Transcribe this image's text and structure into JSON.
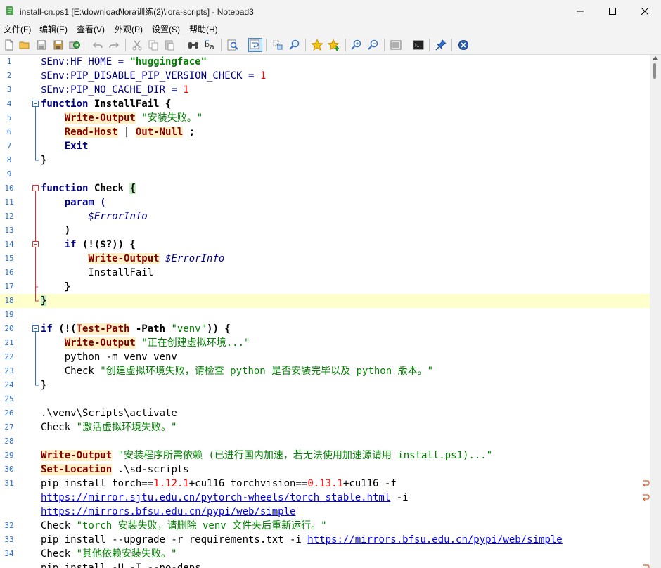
{
  "window": {
    "title": "install-cn.ps1 [E:\\download\\lora训练(2)\\lora-scripts] - Notepad3",
    "app_icon": "notepad3-icon"
  },
  "menu": [
    "文件(F)",
    "编辑(E)",
    "查看(V)",
    "外观(P)",
    "设置(S)",
    "帮助(H)"
  ],
  "toolbar_icons": [
    "new-file-icon",
    "open-folder-icon",
    "save-icon",
    "save-as-icon",
    "browse-icon",
    "undo-icon",
    "redo-icon",
    "cut-icon",
    "copy-icon",
    "paste-icon",
    "find-icon",
    "replace-icon",
    "find-in-files-icon",
    "word-wrap-icon",
    "select-block-icon",
    "zoom-find-icon",
    "add-favorite-icon",
    "favorites-icon",
    "zoom-in-icon",
    "zoom-out-icon",
    "document-view-icon",
    "command-prompt-icon",
    "pin-icon",
    "close-file-icon"
  ],
  "line_numbers": [
    "1",
    "2",
    "3",
    "4",
    "5",
    "6",
    "7",
    "8",
    "",
    "10",
    "11",
    "12",
    "13",
    "14",
    "15",
    "16",
    "17",
    "18",
    "",
    "20",
    "21",
    "22",
    "23",
    "24",
    "",
    "26",
    "27",
    "28",
    "29",
    "30",
    "31",
    "",
    "",
    "32",
    "33",
    "34"
  ],
  "code": {
    "l1": [
      "$Env:HF_HOME = ",
      "\"huggingface\""
    ],
    "l2": [
      "$Env:PIP_DISABLE_PIP_VERSION_CHECK = ",
      "1"
    ],
    "l3": [
      "$Env:PIP_NO_CACHE_DIR = ",
      "1"
    ],
    "l4": [
      "function",
      " InstallFail {"
    ],
    "l5": [
      "    ",
      "Write-Output",
      " ",
      "\"安装失败。\""
    ],
    "l6": [
      "    ",
      "Read-Host",
      " | ",
      "Out-Null",
      " ;"
    ],
    "l7": [
      "    Exit"
    ],
    "l8": [
      "}"
    ],
    "l10": [
      "function",
      " Check ",
      "{"
    ],
    "l11": [
      "    param ("
    ],
    "l12": [
      "        ",
      "$ErrorInfo"
    ],
    "l13": [
      "    )"
    ],
    "l14": [
      "    if",
      " (!($?)) {"
    ],
    "l15": [
      "        ",
      "Write-Output",
      " ",
      "$ErrorInfo"
    ],
    "l16": [
      "        InstallFail"
    ],
    "l17": [
      "    }"
    ],
    "l18": [
      "}"
    ],
    "l20": [
      "if",
      " (!(",
      "Test-Path",
      " -Path ",
      "\"venv\"",
      ")) {"
    ],
    "l21": [
      "    ",
      "Write-Output",
      " ",
      "\"正在创建虚拟环境...\""
    ],
    "l22": [
      "    python -m venv venv"
    ],
    "l23": [
      "    Check ",
      "\"创建虚拟环境失败，请检查 python 是否安装完毕以及 python 版本。\""
    ],
    "l24": [
      "}"
    ],
    "l26": [
      ".\\venv\\Scripts\\activate"
    ],
    "l27": [
      "Check ",
      "\"激活虚拟环境失败。\""
    ],
    "l29": [
      "Write-Output",
      " ",
      "\"安装程序所需依赖 (已进行国内加速，若无法使用加速源请用 install.ps1)...\""
    ],
    "l30": [
      "Set-Location",
      " .\\sd-scripts"
    ],
    "l31a": [
      "pip install torch==",
      "1.12.1",
      "+cu116 torchvision==",
      "0.13.1",
      "+cu116 -f"
    ],
    "l31b": [
      "https://mirror.sjtu.edu.cn/pytorch-wheels/torch_stable.html",
      " -i"
    ],
    "l31c": [
      "https://mirrors.bfsu.edu.cn/pypi/web/simple"
    ],
    "l32": [
      "Check ",
      "\"torch 安装失败，请删除 venv 文件夹后重新运行。\""
    ],
    "l33": [
      "pip install --upgrade -r requirements.txt -i ",
      "https://mirrors.bfsu.edu.cn/pypi/web/simple"
    ],
    "l34": [
      "Check ",
      "\"其他依赖安装失败。\""
    ],
    "l35": [
      "pip install -U -I --no-deps"
    ]
  },
  "colors": {
    "line_number": "#2b6fd6",
    "keyword": "#000080",
    "cmdlet": "#800000",
    "cmdlet_bg": "#fff0c8",
    "string": "#008000",
    "number": "#ff0000",
    "url": "#0000ee",
    "current_line": "#ffffcc",
    "brace_match": "#c4f0c4",
    "wrap_marker": "#e06030"
  }
}
